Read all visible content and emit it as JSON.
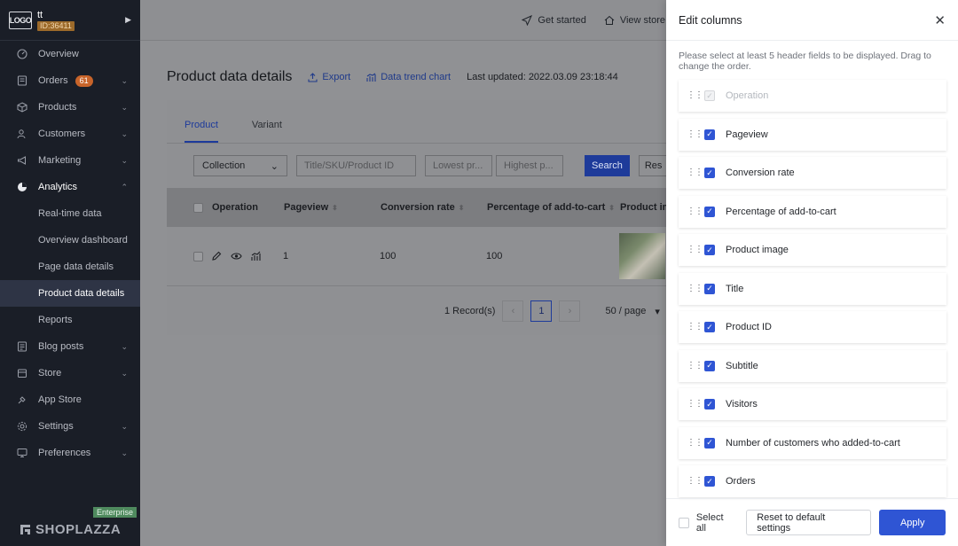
{
  "sidebar": {
    "logo_text": "LOGO",
    "store_name": "tt",
    "store_id": "ID:36411",
    "collapse_icon": "caret-right-icon",
    "nav": [
      {
        "label": "Overview",
        "icon": "dashboard-icon",
        "chevron": false
      },
      {
        "label": "Orders",
        "icon": "orders-icon",
        "badge": "61",
        "chevron": true
      },
      {
        "label": "Products",
        "icon": "box-icon",
        "chevron": true
      },
      {
        "label": "Customers",
        "icon": "users-icon",
        "chevron": true
      },
      {
        "label": "Marketing",
        "icon": "megaphone-icon",
        "chevron": true
      },
      {
        "label": "Analytics",
        "icon": "pie-chart-icon",
        "chevron": true,
        "open": true
      },
      {
        "label": "Blog posts",
        "icon": "blog-icon",
        "chevron": true
      },
      {
        "label": "Store",
        "icon": "store-icon",
        "chevron": true
      },
      {
        "label": "App Store",
        "icon": "plugin-icon",
        "chevron": false
      },
      {
        "label": "Settings",
        "icon": "gear-icon",
        "chevron": true
      },
      {
        "label": "Preferences",
        "icon": "monitor-icon",
        "chevron": true
      }
    ],
    "analytics_sub": [
      "Real-time data",
      "Overview dashboard",
      "Page data details",
      "Product data details",
      "Reports"
    ],
    "active_sub": "Product data details",
    "enterprise_label": "Enterprise",
    "brand": "SHOPLAZZA"
  },
  "topbar": {
    "get_started": "Get started",
    "view_store": "View store"
  },
  "page": {
    "title": "Product data details",
    "export": "Export",
    "trend": "Data trend chart",
    "last_updated": "Last updated: 2022.03.09 23:18:44"
  },
  "tabs": [
    "Product",
    "Variant"
  ],
  "filters": {
    "collection": "Collection",
    "search_placeholder": "Title/SKU/Product ID",
    "lowest_placeholder": "Lowest pr...",
    "highest_placeholder": "Highest p...",
    "search_btn": "Search",
    "reset_btn": "Res"
  },
  "table": {
    "headers": [
      "Operation",
      "Pageview",
      "Conversion rate",
      "Percentage of add-to-cart",
      "Product im"
    ],
    "rows": [
      {
        "pageview": "1",
        "conversion": "100",
        "add_to_cart": "100"
      }
    ]
  },
  "pagination": {
    "records": "1 Record(s)",
    "current": "1",
    "page_size": "50 / page"
  },
  "drawer": {
    "title": "Edit columns",
    "hint": "Please select at least 5 header fields to be displayed. Drag to change the order.",
    "columns": [
      {
        "label": "Operation",
        "checked": true,
        "disabled": true
      },
      {
        "label": "Pageview",
        "checked": true
      },
      {
        "label": "Conversion rate",
        "checked": true
      },
      {
        "label": "Percentage of add-to-cart",
        "checked": true
      },
      {
        "label": "Product image",
        "checked": true
      },
      {
        "label": "Title",
        "checked": true
      },
      {
        "label": "Product ID",
        "checked": true
      },
      {
        "label": "Subtitle",
        "checked": true
      },
      {
        "label": "Visitors",
        "checked": true
      },
      {
        "label": "Number of customers who added-to-cart",
        "checked": true
      },
      {
        "label": "Orders",
        "checked": true
      }
    ],
    "select_all": "Select all",
    "reset_default": "Reset to default settings",
    "apply": "Apply"
  },
  "colors": {
    "accent": "#2f55d4",
    "sidebar_bg": "#1a1e27",
    "badge": "#c8642a"
  }
}
